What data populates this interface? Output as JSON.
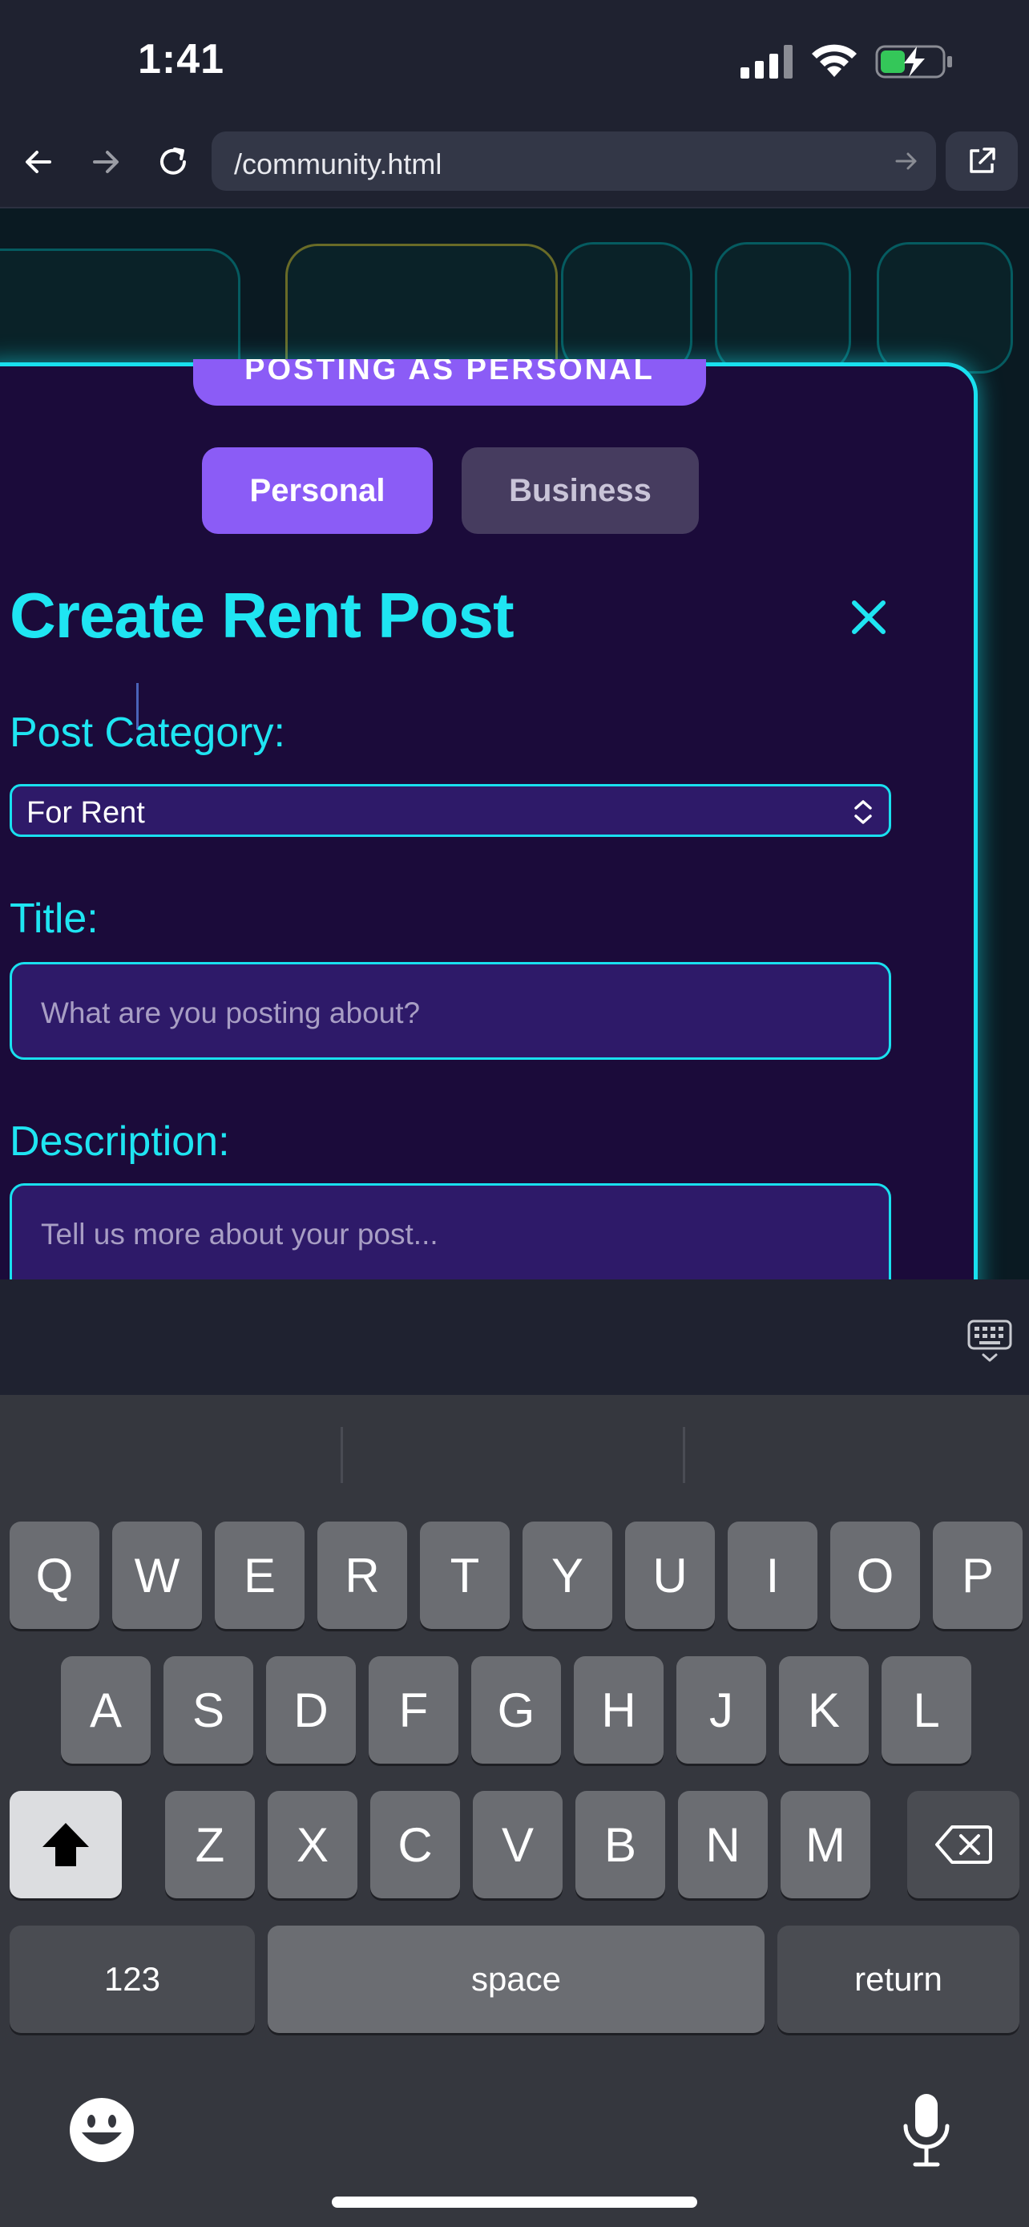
{
  "status_bar": {
    "time": "1:41"
  },
  "browser": {
    "url": "/community.html"
  },
  "modal": {
    "posting_badge": "POSTING AS PERSONAL",
    "account_toggle": {
      "personal": "Personal",
      "business": "Business",
      "selected": "Personal"
    },
    "title": "Create Rent Post",
    "category_label": "Post Category:",
    "category_value": "For Rent",
    "title_label": "Title:",
    "title_placeholder": "What are you posting about?",
    "description_label": "Description:",
    "description_placeholder": "Tell us more about your post..."
  },
  "keyboard": {
    "row1": [
      "Q",
      "W",
      "E",
      "R",
      "T",
      "Y",
      "U",
      "I",
      "O",
      "P"
    ],
    "row2": [
      "A",
      "S",
      "D",
      "F",
      "G",
      "H",
      "J",
      "K",
      "L"
    ],
    "row3": [
      "Z",
      "X",
      "C",
      "V",
      "B",
      "N",
      "M"
    ],
    "numbers_key": "123",
    "space_key": "space",
    "return_key": "return"
  },
  "colors": {
    "accent_cyan": "#19e0ef",
    "accent_purple": "#8b5cf6",
    "modal_bg": "#1b0b3a"
  }
}
